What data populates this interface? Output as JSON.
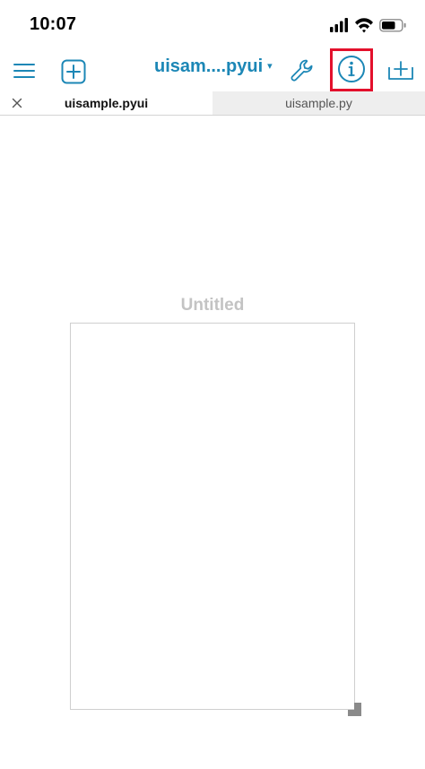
{
  "status_bar": {
    "time": "10:07",
    "icons": [
      "cellular-signal-icon",
      "wifi-icon",
      "battery-icon"
    ]
  },
  "toolbar": {
    "document_title": "uisam....pyui",
    "title_caret": "▾",
    "buttons": [
      "menu-icon",
      "add-icon",
      "wrench-icon",
      "info-icon",
      "add-to-icon"
    ]
  },
  "tabs": [
    {
      "label": "uisample.pyui",
      "active": true
    },
    {
      "label": "uisample.py",
      "active": false
    }
  ],
  "canvas": {
    "view_title": "Untitled"
  },
  "colors": {
    "accent": "#1c87b6",
    "highlight": "#e3102c",
    "inactive_tab": "#eeeeee",
    "placeholder_text": "#c3c3c3"
  }
}
